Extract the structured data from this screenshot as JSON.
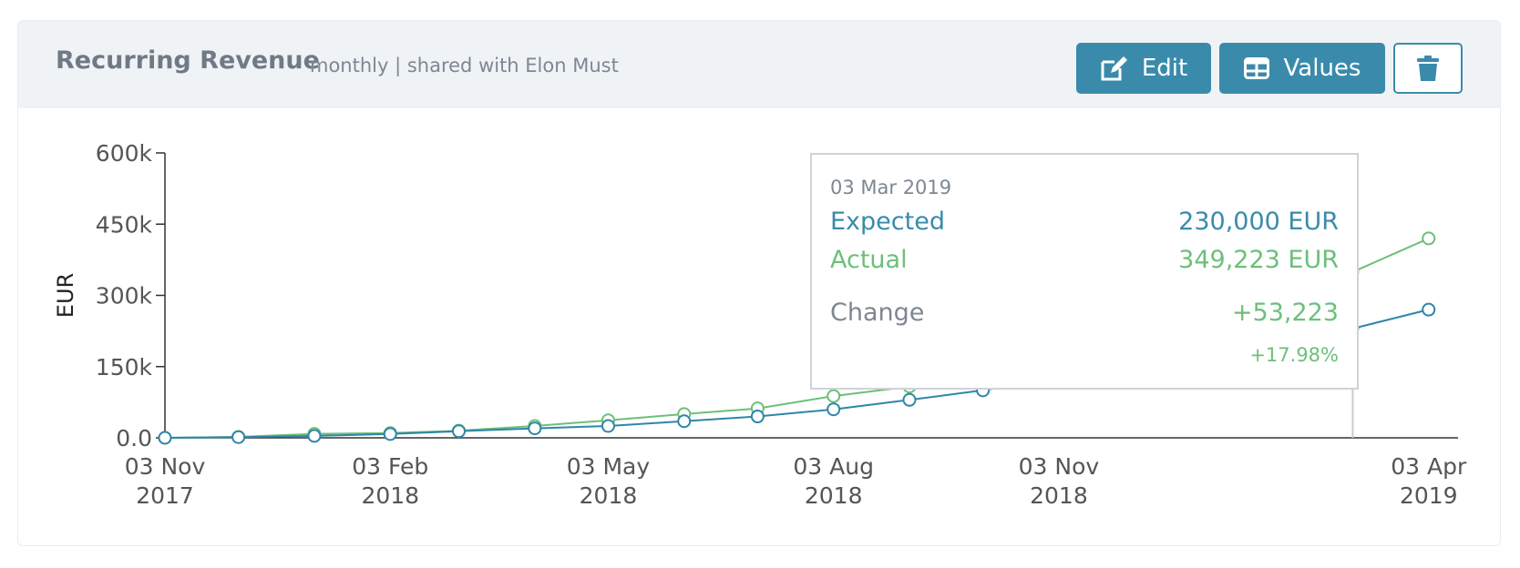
{
  "header": {
    "title": "Recurring Revenue",
    "subtitle": "monthly | shared with Elon Must",
    "edit_label": "Edit",
    "values_label": "Values",
    "icons": {
      "edit": "edit-icon",
      "values": "table-icon",
      "delete": "trash-icon"
    }
  },
  "colors": {
    "accent": "#3a8bab",
    "expected": "#2f86a8",
    "actual": "#6dbf7a",
    "header_bg": "#f0f3f6"
  },
  "tooltip": {
    "date": "03 Mar 2019",
    "expected_label": "Expected",
    "expected_value": "230,000 EUR",
    "actual_label": "Actual",
    "actual_value": "349,223 EUR",
    "change_label": "Change",
    "change_value": "+53,223",
    "change_pct": "+17.98%"
  },
  "chart_data": {
    "type": "line",
    "title": "",
    "xlabel": "",
    "ylabel": "EUR",
    "ylim": [
      0,
      600000
    ],
    "yticks": [
      {
        "value": 0,
        "label": "0.0"
      },
      {
        "value": 150000,
        "label": "150k"
      },
      {
        "value": 300000,
        "label": "300k"
      },
      {
        "value": 450000,
        "label": "450k"
      },
      {
        "value": 600000,
        "label": "600k"
      }
    ],
    "xticks": [
      {
        "date": "2017-11-03",
        "line1": "03 Nov",
        "line2": "2017"
      },
      {
        "date": "2018-02-03",
        "line1": "03 Feb",
        "line2": "2018"
      },
      {
        "date": "2018-05-03",
        "line1": "03 May",
        "line2": "2018"
      },
      {
        "date": "2018-08-03",
        "line1": "03 Aug",
        "line2": "2018"
      },
      {
        "date": "2018-11-03",
        "line1": "03 Nov",
        "line2": "2018"
      },
      {
        "date": "2019-04-03",
        "line1": "03 Apr",
        "line2": "2019"
      }
    ],
    "x": [
      "2017-11-03",
      "2017-12-03",
      "2018-01-03",
      "2018-02-03",
      "2018-03-03",
      "2018-04-03",
      "2018-05-03",
      "2018-06-03",
      "2018-07-03",
      "2018-08-03",
      "2018-09-03",
      "2018-10-03",
      "2018-11-03",
      "2018-12-03",
      "2019-01-03",
      "2019-02-03",
      "2019-03-03",
      "2019-04-03"
    ],
    "series": [
      {
        "name": "Expected",
        "color": "#2f86a8",
        "values": [
          0,
          1500,
          4000,
          8000,
          14000,
          20000,
          25000,
          35000,
          45000,
          60000,
          80000,
          100000,
          125000,
          150000,
          170000,
          195000,
          230000,
          270000
        ]
      },
      {
        "name": "Actual",
        "color": "#6dbf7a",
        "values": [
          0,
          2000,
          8500,
          10000,
          15000,
          25000,
          37000,
          50000,
          62000,
          88000,
          108000,
          135000,
          165000,
          200000,
          235000,
          290000,
          349223,
          420000
        ]
      }
    ],
    "highlight_date": "2019-03-03",
    "grid": false,
    "legend": "none"
  }
}
